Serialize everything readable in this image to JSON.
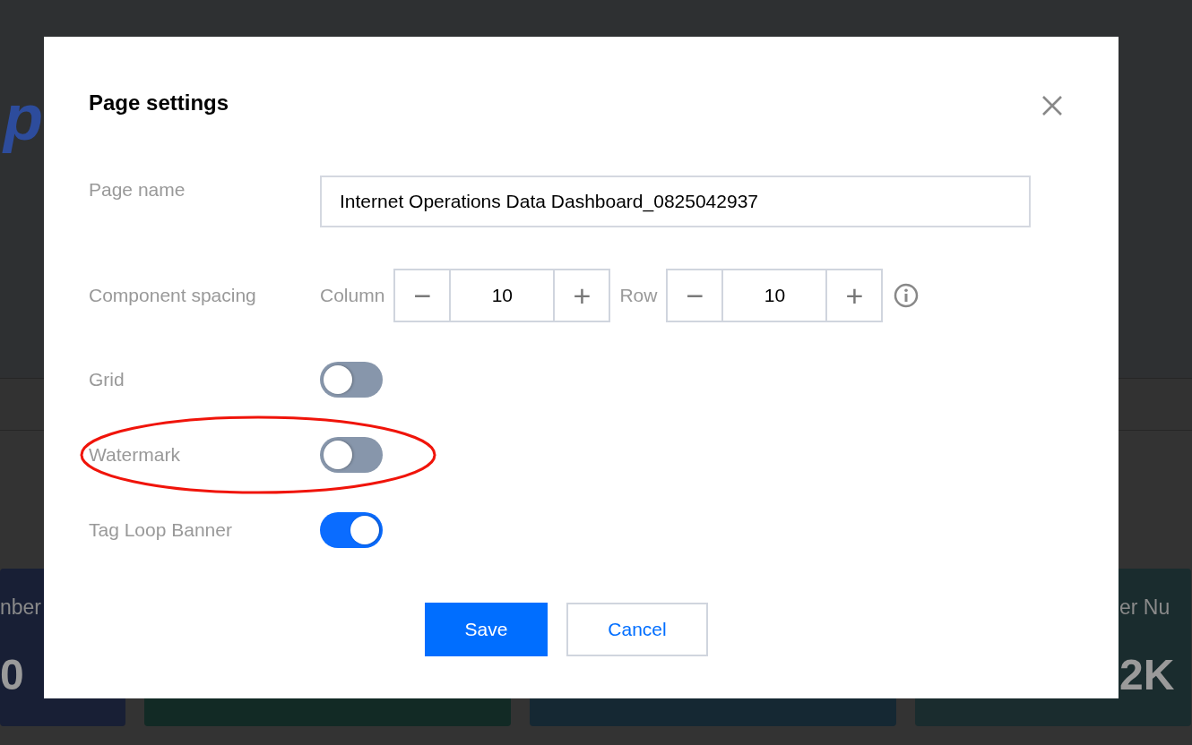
{
  "background": {
    "logo_text": "p",
    "cards": [
      {
        "label": "nber",
        "value": "0",
        "color": "#181f35"
      },
      {
        "color": "#122a25"
      },
      {
        "color": "#152833"
      },
      {
        "label": "er Nu",
        "value": "2K",
        "color": "#1a2c2e"
      }
    ]
  },
  "dialog": {
    "title": "Page settings",
    "page_name": {
      "label": "Page name",
      "value": "Internet Operations Data Dashboard_0825042937"
    },
    "spacing": {
      "label": "Component spacing",
      "steppers": [
        {
          "label": "Column",
          "minus": "−",
          "value": "10",
          "plus": "+"
        },
        {
          "label": "Row",
          "minus": "−",
          "value": "10",
          "plus": "+"
        }
      ]
    },
    "toggles": [
      {
        "label": "Grid",
        "on": false,
        "highlighted": false
      },
      {
        "label": "Watermark",
        "on": false,
        "highlighted": true
      },
      {
        "label": "Tag Loop Banner",
        "on": true,
        "highlighted": false
      }
    ],
    "buttons": [
      {
        "label": "Save",
        "kind": "primary"
      },
      {
        "label": "Cancel",
        "kind": "secondary"
      }
    ]
  }
}
